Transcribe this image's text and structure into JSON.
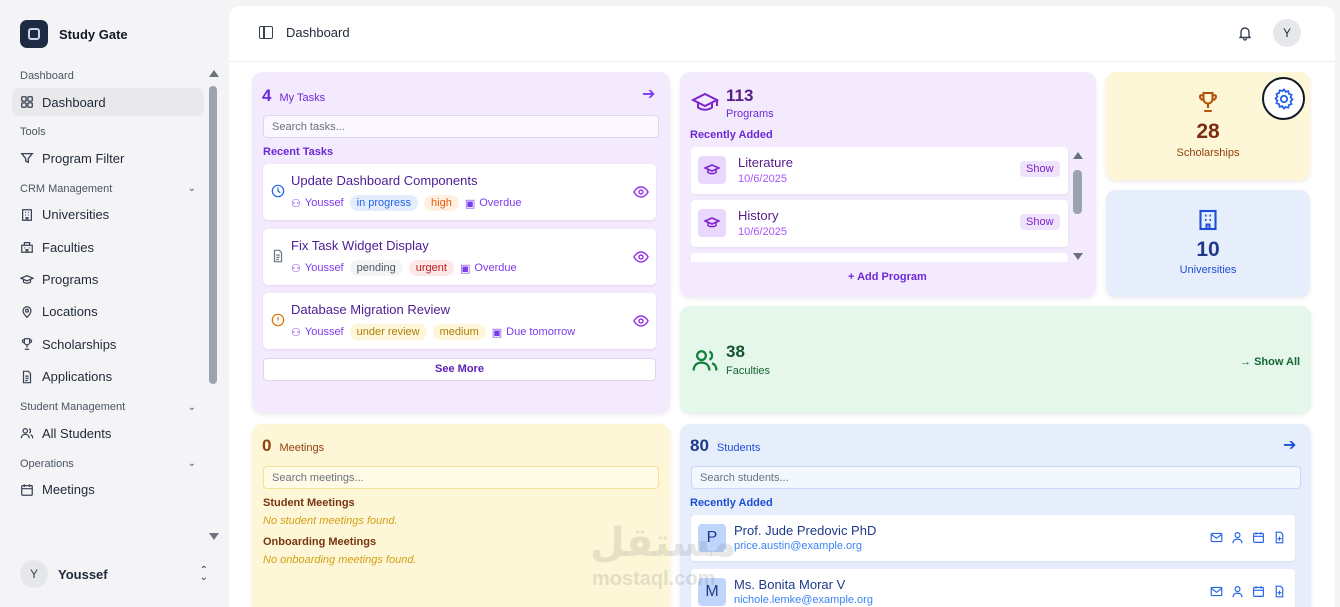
{
  "brand": {
    "name": "Study Gate"
  },
  "sidebar": {
    "groups": [
      {
        "label": "Dashboard",
        "items": [
          {
            "label": "Dashboard",
            "icon": "grid-icon",
            "active": true
          }
        ]
      },
      {
        "label": "Tools",
        "items": [
          {
            "label": "Program Filter",
            "icon": "filter-icon"
          }
        ]
      },
      {
        "label": "CRM Management",
        "items": [
          {
            "label": "Universities",
            "icon": "building-icon"
          },
          {
            "label": "Faculties",
            "icon": "faculty-building-icon"
          },
          {
            "label": "Programs",
            "icon": "graduation-cap-icon"
          },
          {
            "label": "Locations",
            "icon": "map-pin-icon"
          },
          {
            "label": "Scholarships",
            "icon": "trophy-icon"
          },
          {
            "label": "Applications",
            "icon": "document-icon"
          }
        ]
      },
      {
        "label": "Student Management",
        "items": [
          {
            "label": "All Students",
            "icon": "users-icon"
          }
        ]
      },
      {
        "label": "Operations",
        "items": [
          {
            "label": "Meetings",
            "icon": "calendar-icon"
          }
        ]
      }
    ],
    "user": {
      "initial": "Y",
      "name": "Youssef"
    }
  },
  "topbar": {
    "breadcrumb": "Dashboard",
    "avatar_initial": "Y"
  },
  "tasks": {
    "count": "4",
    "title": "My Tasks",
    "search_placeholder": "Search tasks...",
    "section_label": "Recent Tasks",
    "items": [
      {
        "title": "Update Dashboard Components",
        "user": "Youssef",
        "status": "in progress",
        "priority": "high",
        "due": "Overdue",
        "icon": "clock-icon"
      },
      {
        "title": "Fix Task Widget Display",
        "user": "Youssef",
        "status": "pending",
        "priority": "urgent",
        "due": "Overdue",
        "icon": "file-icon"
      },
      {
        "title": "Database Migration Review",
        "user": "Youssef",
        "status": "under review",
        "priority": "medium",
        "due": "Due tomorrow",
        "icon": "alert-circle-icon"
      }
    ],
    "see_more": "See More"
  },
  "programs": {
    "count": "113",
    "title": "Programs",
    "section_label": "Recently Added",
    "items": [
      {
        "name": "Literature",
        "date": "10/6/2025",
        "action": "Show"
      },
      {
        "name": "History",
        "date": "10/6/2025",
        "action": "Show"
      }
    ],
    "add_label": "Add Program"
  },
  "scholarships": {
    "count": "28",
    "label": "Scholarships"
  },
  "universities": {
    "count": "10",
    "label": "Universities"
  },
  "faculties": {
    "count": "38",
    "label": "Faculties",
    "show_all": "Show All"
  },
  "meetings": {
    "count": "0",
    "title": "Meetings",
    "search_placeholder": "Search meetings...",
    "student_label": "Student Meetings",
    "student_empty": "No student meetings found.",
    "onboarding_label": "Onboarding Meetings",
    "onboarding_empty": "No onboarding meetings found."
  },
  "students": {
    "count": "80",
    "title": "Students",
    "search_placeholder": "Search students...",
    "section_label": "Recently Added",
    "items": [
      {
        "initial": "P",
        "name": "Prof. Jude Predovic PhD",
        "email": "price.austin@example.org"
      },
      {
        "initial": "M",
        "name": "Ms. Bonita Morar V",
        "email": "nichole.lemke@example.org"
      }
    ]
  },
  "watermark": {
    "text": "مستقل",
    "sub": "mostaql.com"
  },
  "colors": {
    "purple": "#6d28d9",
    "blue": "#1d4ed8",
    "green": "#166534",
    "amber": "#92400e"
  }
}
